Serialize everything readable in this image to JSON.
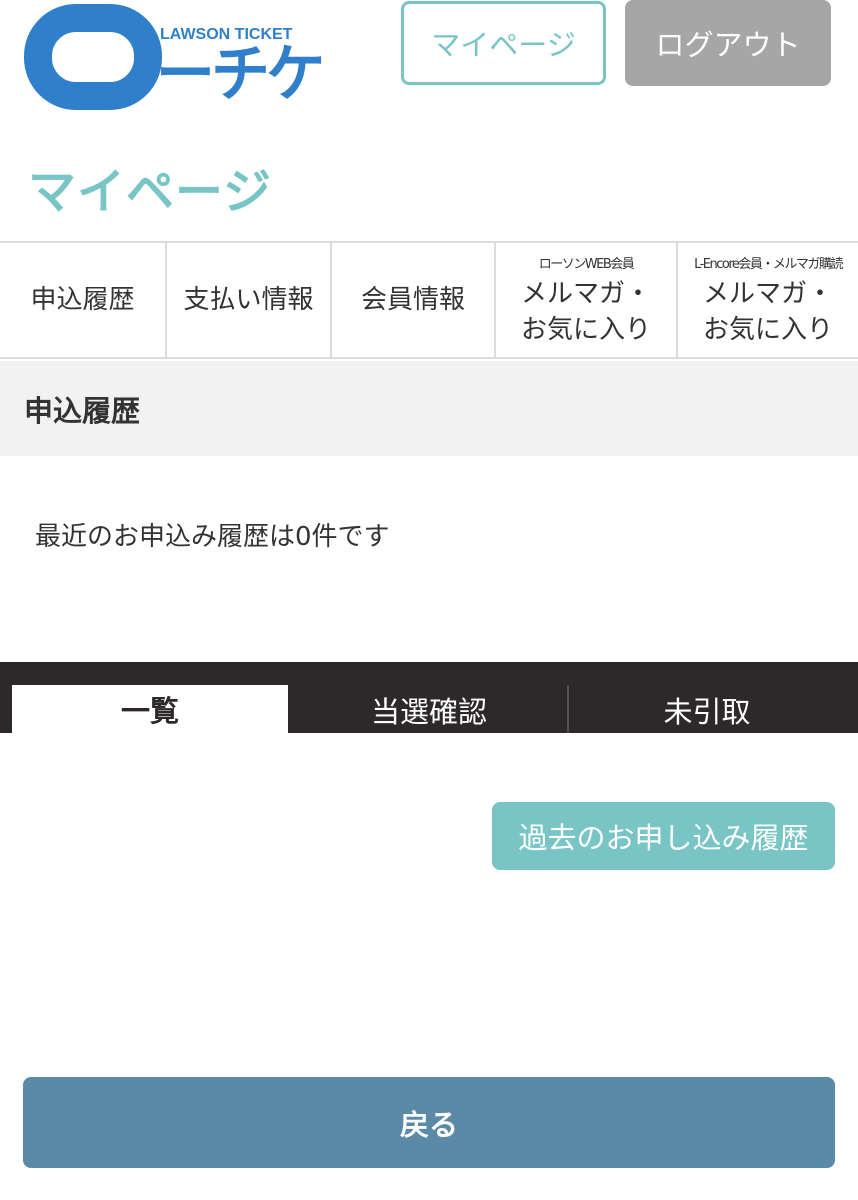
{
  "header": {
    "logo": {
      "small_text": "LAWSON TICKET",
      "big_text": "ーチケ",
      "color": "#2f7fca"
    },
    "mypage_button": "マイページ",
    "logout_button": "ログアウト"
  },
  "page_title": "マイページ",
  "nav": {
    "items": [
      {
        "lines": [
          "申込履歴"
        ]
      },
      {
        "lines": [
          "支払い情報"
        ]
      },
      {
        "lines": [
          "会員情報"
        ]
      },
      {
        "small": "ローソンWEB会員",
        "lines": [
          "メルマガ・",
          "お気に入り"
        ]
      },
      {
        "small": "L-Encore会員・メルマガ購読",
        "lines": [
          "メルマガ・",
          "お気に入り"
        ]
      }
    ]
  },
  "section": {
    "title": "申込履歴",
    "recent_text": "最近のお申込み履歴は0件です"
  },
  "tabs": [
    "一覧",
    "当選確認",
    "未引取"
  ],
  "past_button": "過去のお申し込み履歴",
  "back_button": "戻る",
  "colors": {
    "accent": "#79c5c5",
    "logout_bg": "#a6a6a6",
    "dark_bar": "#2d292a",
    "back_button": "#5b89a8"
  }
}
